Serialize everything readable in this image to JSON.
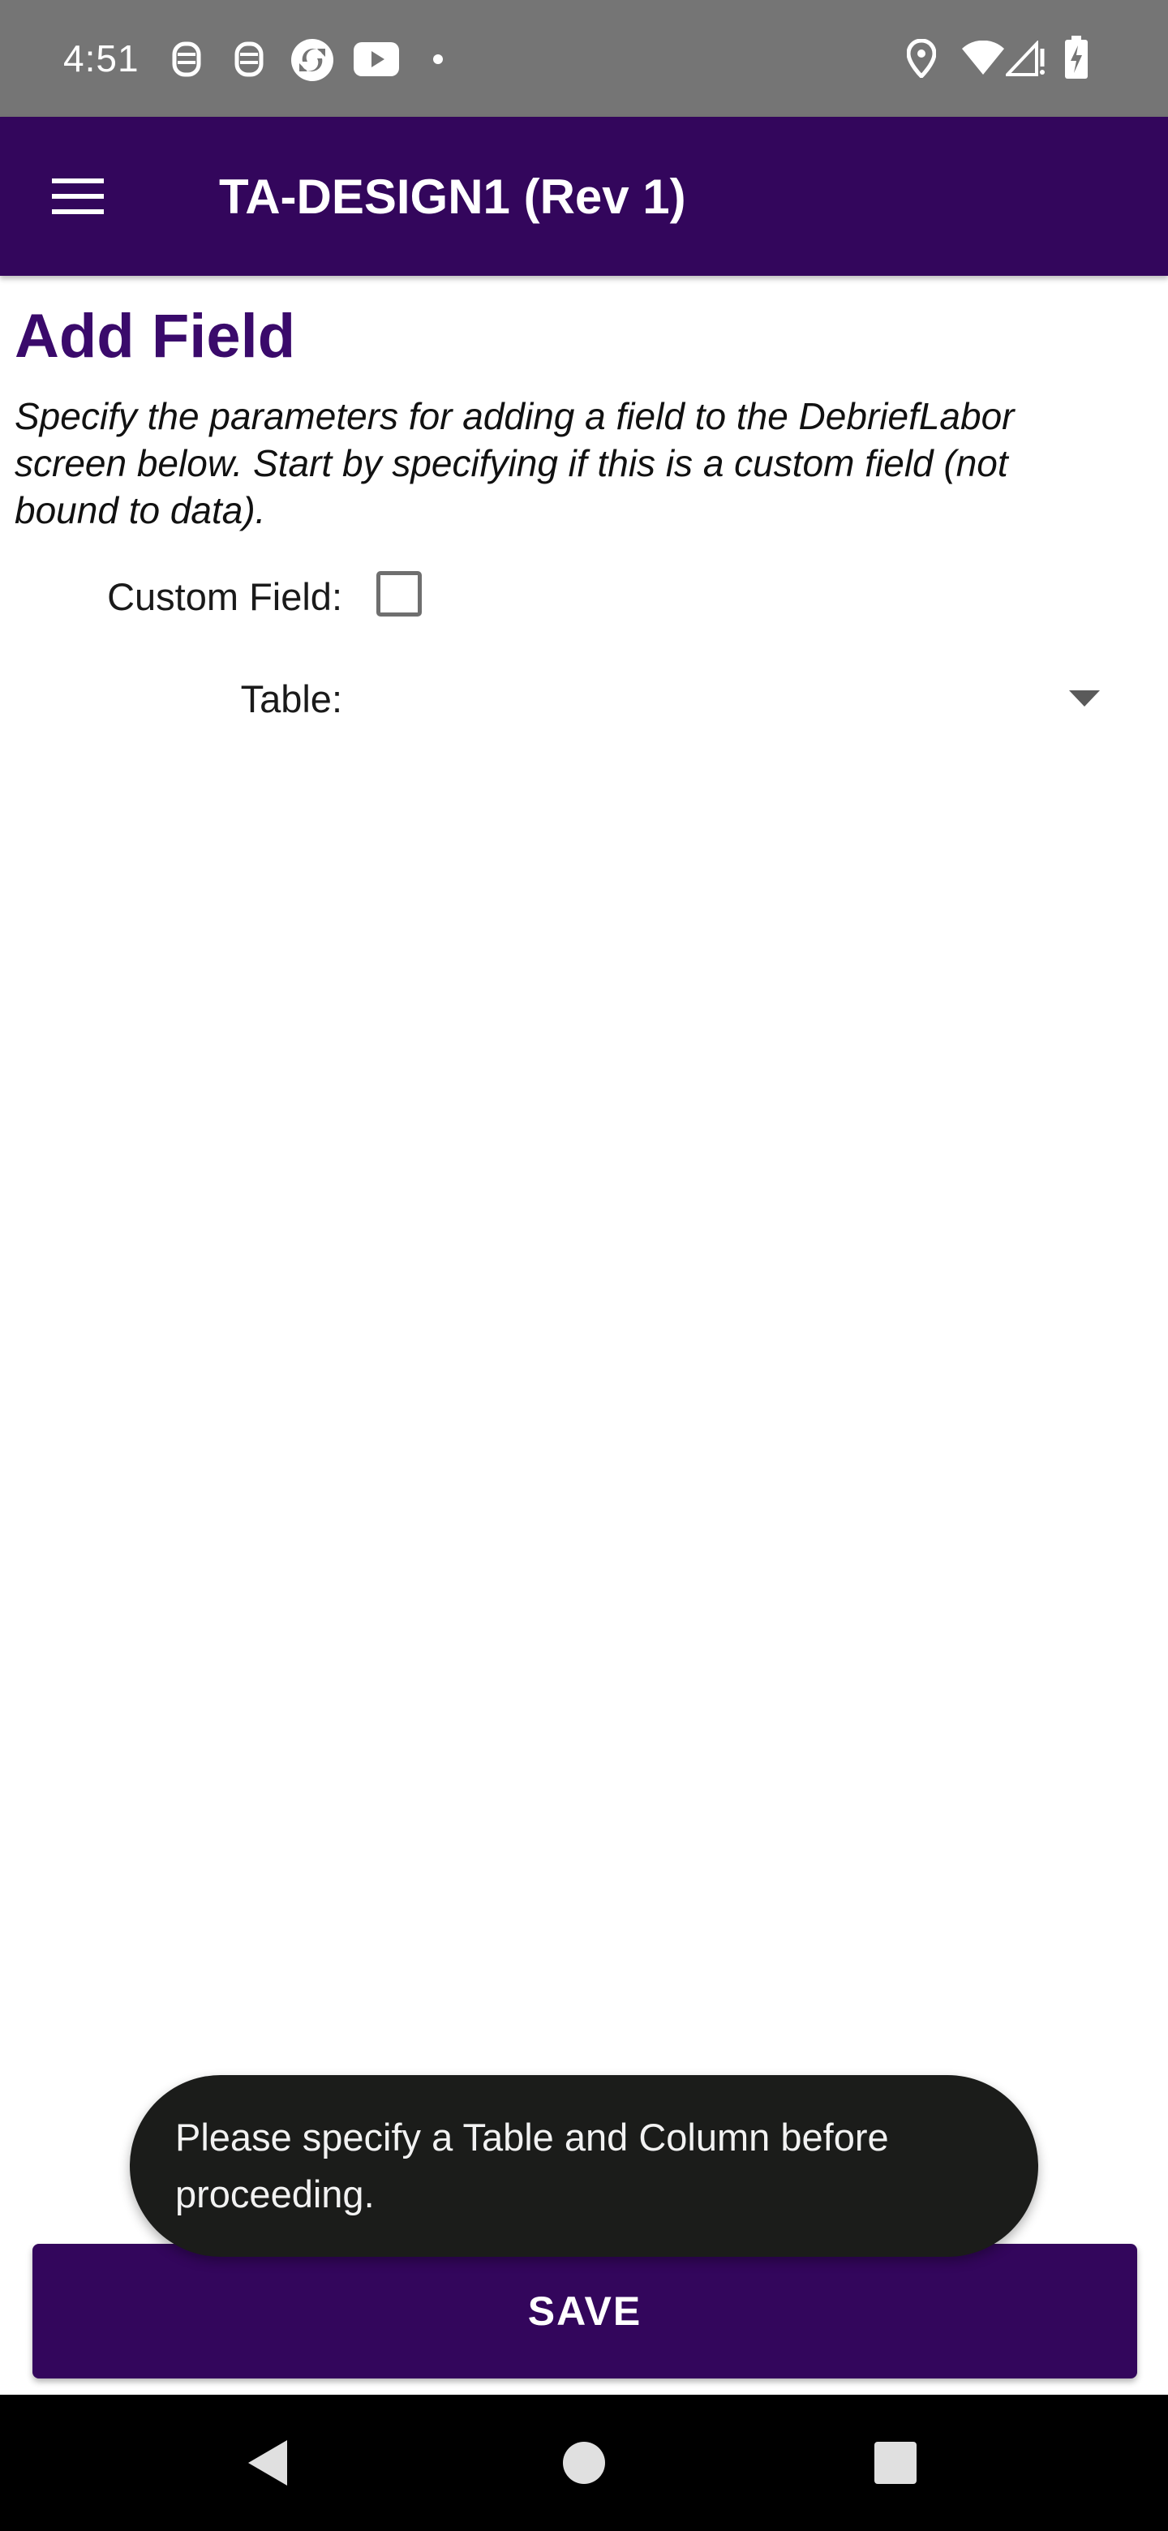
{
  "status_bar": {
    "time": "4:51",
    "left_icons": [
      "notification-icon",
      "notification-icon",
      "sync-app-icon",
      "youtube-icon",
      "dot-icon"
    ],
    "right_icons": [
      "location-icon",
      "wifi-icon",
      "signal-icon",
      "battery-charging-icon"
    ]
  },
  "app_bar": {
    "menu_icon": "hamburger-menu-icon",
    "title": "TA-DESIGN1 (Rev 1)"
  },
  "page": {
    "title": "Add Field",
    "description": "Specify the parameters for adding a field to the DebriefLabor screen below. Start by specifying if this is a custom field (not bound to data)."
  },
  "form": {
    "custom_field_label": "Custom Field:",
    "custom_field_checked": false,
    "table_label": "Table:",
    "table_value": ""
  },
  "toast": {
    "message": "Please specify a Table and Column before proceeding."
  },
  "actions": {
    "save_label": "SAVE"
  },
  "nav_bar": {
    "icons": [
      "back-icon",
      "home-icon",
      "recents-icon"
    ]
  },
  "colors": {
    "primary": "#33065c",
    "title_text": "#3a0a6b",
    "status_bar": "#757575",
    "toast_bg": "#1b1c1a"
  }
}
